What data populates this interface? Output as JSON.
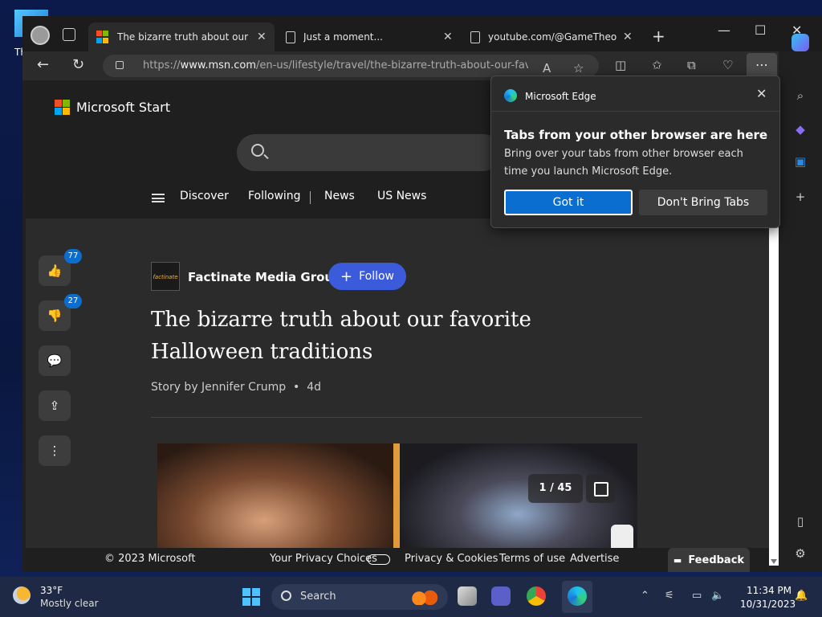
{
  "desktop": {
    "icon_label": "Th"
  },
  "tabs": [
    {
      "title": "The bizarre truth about our fav",
      "active": true
    },
    {
      "title": "Just a moment...",
      "active": false
    },
    {
      "title": "youtube.com/@GameTheory/v",
      "active": false
    }
  ],
  "address": {
    "scheme": "https://",
    "host": "www.msn.com",
    "path": "/en-us/lifestyle/travel/the-bizarre-truth-about-our-fav..."
  },
  "site": {
    "brand": "Microsoft Start",
    "nav": [
      "Discover",
      "Following",
      "News",
      "US News"
    ]
  },
  "social": {
    "likes": "77",
    "dislikes": "27"
  },
  "article": {
    "publisher": "Factinate Media Group",
    "publisher_logo": "factinate",
    "follow_label": "Follow",
    "headline": "The bizarre truth about our favorite Halloween traditions",
    "byline": "Story by Jennifer Crump",
    "age": "4d",
    "gallery_counter": "1 / 45"
  },
  "footer": {
    "copyright": "© 2023 Microsoft",
    "privacy_choices": "Your Privacy Choices",
    "privacy_cookies": "Privacy & Cookies",
    "terms": "Terms of use",
    "advertise": "Advertise",
    "feedback": "Feedback"
  },
  "popup": {
    "brand": "Microsoft Edge",
    "title": "Tabs from your other browser are here",
    "body": "Bring over your tabs from other browser each time you launch Microsoft Edge.",
    "primary_label": "Got it",
    "secondary_label": "Don't Bring Tabs"
  },
  "taskbar": {
    "temperature": "33°F",
    "condition": "Mostly clear",
    "search_label": "Search",
    "time": "11:34 PM",
    "date": "10/31/2023"
  },
  "colors": {
    "accent": "#0a6ed1",
    "follow": "#3b5bdb",
    "ms_red": "#f25022",
    "ms_green": "#7fba00",
    "ms_blue": "#00a4ef",
    "ms_yellow": "#ffb900"
  }
}
